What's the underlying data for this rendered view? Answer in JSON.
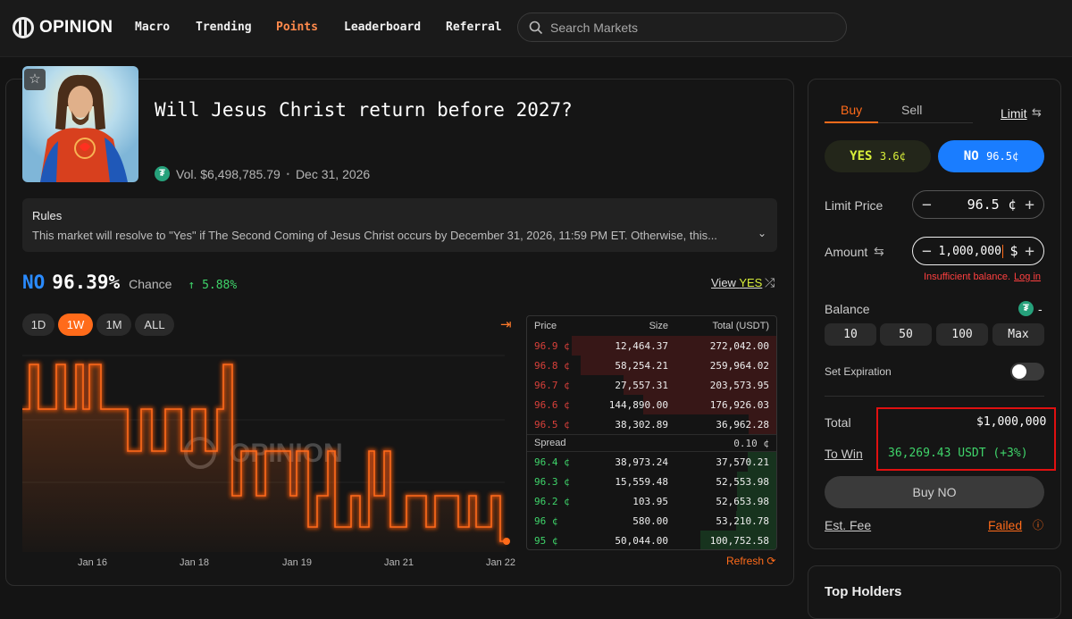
{
  "brand": {
    "name": "OPINION"
  },
  "nav": [
    "Macro",
    "Trending",
    "Points",
    "Leaderboard",
    "Referral"
  ],
  "search": {
    "placeholder": "Search Markets"
  },
  "market": {
    "title": "Will Jesus Christ return before 2027?",
    "volume": "Vol. $6,498,785.79",
    "separator": "•",
    "end_date": "Dec 31, 2026",
    "rules_title": "Rules",
    "rules_text": "This market will resolve to \"Yes\" if The Second Coming of Jesus Christ occurs by December 31, 2026, 11:59 PM ET. Otherwise, this..."
  },
  "chance": {
    "outcome": "NO",
    "value": "96.39%",
    "label": "Chance",
    "delta": "↑ 5.88%"
  },
  "view_toggle": {
    "prefix": "View",
    "outcome": "YES"
  },
  "ranges": [
    "1D",
    "1W",
    "1M",
    "ALL"
  ],
  "x_ticks": [
    "Jan 16",
    "Jan 18",
    "Jan 19",
    "Jan 21",
    "Jan 22"
  ],
  "watermark": "OPINION",
  "orderbook": {
    "headers": {
      "price": "Price",
      "size": "Size",
      "total": "Total (USDT)"
    },
    "asks": [
      {
        "price": "96.9 ¢",
        "size": "12,464.37",
        "total": "272,042.00"
      },
      {
        "price": "96.8 ¢",
        "size": "58,254.21",
        "total": "259,964.02"
      },
      {
        "price": "96.7 ¢",
        "size": "27,557.31",
        "total": "203,573.95"
      },
      {
        "price": "96.6 ¢",
        "size": "144,890.00",
        "total": "176,926.03"
      },
      {
        "price": "96.5 ¢",
        "size": "38,302.89",
        "total": "36,962.28"
      }
    ],
    "spread_label": "Spread",
    "spread_value": "0.10 ¢",
    "bids": [
      {
        "price": "96.4 ¢",
        "size": "38,973.24",
        "total": "37,570.21"
      },
      {
        "price": "96.3 ¢",
        "size": "15,559.48",
        "total": "52,553.98"
      },
      {
        "price": "96.2 ¢",
        "size": "103.95",
        "total": "52,653.98"
      },
      {
        "price": "96 ¢",
        "size": "580.00",
        "total": "53,210.78"
      },
      {
        "price": "95 ¢",
        "size": "50,044.00",
        "total": "100,752.58"
      }
    ],
    "refresh": "Refresh"
  },
  "trade": {
    "tab_buy": "Buy",
    "tab_sell": "Sell",
    "order_type": "Limit",
    "yes_label": "YES",
    "yes_price": "3.6¢",
    "no_label": "NO",
    "no_price": "96.5¢",
    "limit_price_label": "Limit Price",
    "limit_price_value": "96.5",
    "limit_price_unit": "¢",
    "amount_label": "Amount",
    "amount_value": "1,000,000",
    "amount_unit": "$",
    "error": "Insufficient balance.",
    "error_link": "Log in",
    "balance_label": "Balance",
    "balance_value": "-",
    "balance_presets": [
      "10",
      "50",
      "100",
      "Max"
    ],
    "expiration_label": "Set Expiration",
    "total_label": "Total",
    "total_value": "$1,000,000",
    "to_win_label": "To Win",
    "to_win_value": "36,269.43 USDT (+3%)",
    "buy_button": "Buy NO",
    "fee_label": "Est. Fee",
    "fee_value": "Failed"
  },
  "holders": {
    "title": "Top Holders"
  },
  "colors": {
    "accent": "#ff6b1a",
    "no_blue": "#1a7dff",
    "yes_lime": "#d9f03a",
    "ask_red": "#d8403a",
    "bid_green": "#3fd46a"
  }
}
